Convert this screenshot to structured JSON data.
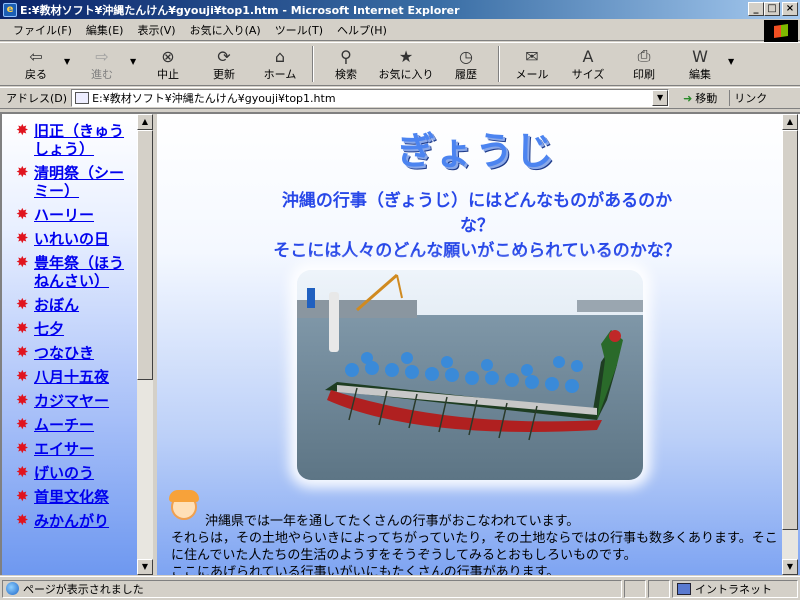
{
  "window": {
    "title": "E:¥教材ソフト¥沖縄たんけん¥gyouji¥top1.htm - Microsoft Internet Explorer",
    "controls": [
      "_",
      "□",
      "×"
    ]
  },
  "menu": [
    "ファイル(F)",
    "編集(E)",
    "表示(V)",
    "お気に入り(A)",
    "ツール(T)",
    "ヘルプ(H)"
  ],
  "toolbar": {
    "back": "戻る",
    "forward": "進む",
    "stop": "中止",
    "refresh": "更新",
    "home": "ホーム",
    "search": "検索",
    "favorites": "お気に入り",
    "history": "履歴",
    "mail": "メール",
    "size": "サイズ",
    "print": "印刷",
    "edit": "編集"
  },
  "address": {
    "label": "アドレス(D)",
    "value": "E:¥教材ソフト¥沖縄たんけん¥gyouji¥top1.htm",
    "go": "移動",
    "links": "リンク"
  },
  "nav": [
    {
      "label": "旧正（きゅうしょう）"
    },
    {
      "label": "清明祭（シーミー）"
    },
    {
      "label": "ハーリー"
    },
    {
      "label": "いれいの日"
    },
    {
      "label": "豊年祭（ほうねんさい）"
    },
    {
      "label": "おぼん"
    },
    {
      "label": "七夕"
    },
    {
      "label": "つなひき"
    },
    {
      "label": "八月十五夜"
    },
    {
      "label": "カジマヤー"
    },
    {
      "label": "ムーチー"
    },
    {
      "label": "エイサー"
    },
    {
      "label": "げいのう"
    },
    {
      "label": "首里文化祭"
    },
    {
      "label": "みかんがり"
    }
  ],
  "main": {
    "title": "ぎょうじ",
    "question1": "沖縄の行事（ぎょうじ）にはどんなものがあるのかな？",
    "question2": "そこには人々のどんな願いがこめられているのかな？",
    "para1": "沖縄県では一年を通してたくさんの行事がおこなわれています。",
    "para2": "それらは，その土地やらいきによってちがっていたり，その土地ならではの行事も数多くあります。そこに住んでいた人たちの生活のようすをそうぞうしてみるとおもしろいものです。",
    "para3": "ここにあげられている行事いがいにもたくさんの行事があります。"
  },
  "status": {
    "text": "ページが表示されました",
    "zone": "イントラネット"
  },
  "colors": {
    "link": "#0000ee",
    "title": "#4c84f0",
    "question": "#2848e8",
    "star": "#e0141e"
  }
}
